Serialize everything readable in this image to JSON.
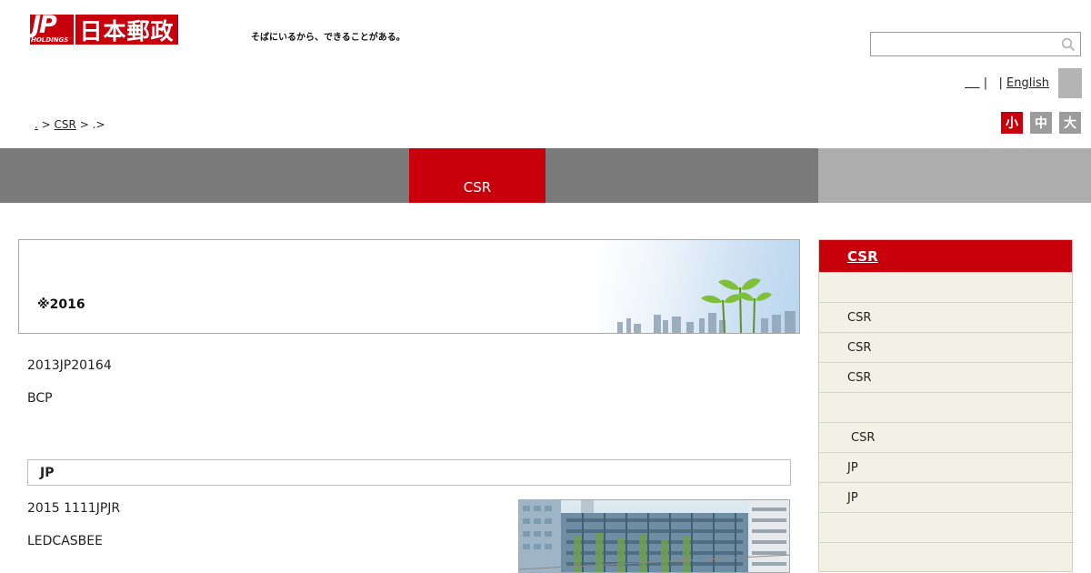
{
  "header": {
    "logo_mark": "JP",
    "logo_sub": "HOLDINGS",
    "logo_name": "日本郵政",
    "tagline": "そばにいるから、できることがある。",
    "search": {
      "value": "",
      "placeholder": ""
    },
    "lang": {
      "sep1": "|",
      "sep2": "|",
      "english": "English"
    }
  },
  "breadcrumb": {
    "home": ".",
    "sep1": ">",
    "csr": "CSR",
    "sep2": ">",
    "current": ".",
    "sep3": ">"
  },
  "font_size": {
    "small": "小",
    "medium": "中",
    "large": "大"
  },
  "nav": {
    "active": "CSR"
  },
  "main": {
    "hero_title": "※2016",
    "para1": "2013JP20164",
    "para2": "BCP",
    "section_title": "JP",
    "para3": "2015 1111JPJR",
    "para4": "LEDCASBEE"
  },
  "sidebar": {
    "title": "CSR",
    "items": [
      "",
      "CSR",
      "CSR",
      "CSR",
      "",
      "CSR",
      "JP",
      "JP",
      "",
      ""
    ]
  },
  "colors": {
    "brand_red": "#c8000b",
    "nav_gray": "#7a7a7a",
    "sidebar_bg": "#f2f1e6"
  }
}
